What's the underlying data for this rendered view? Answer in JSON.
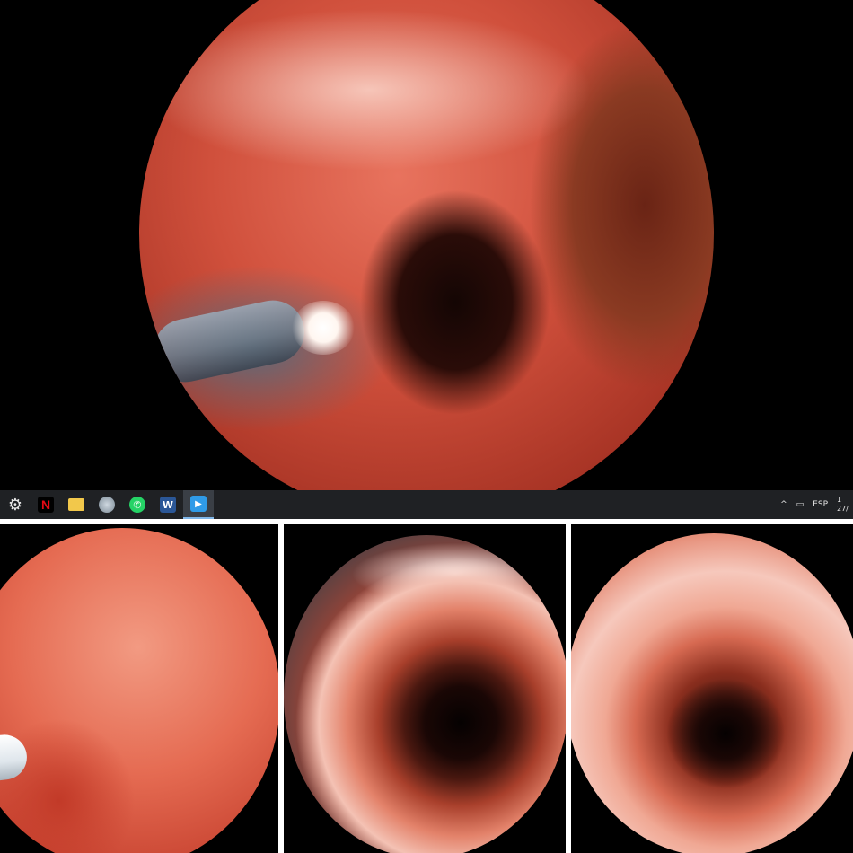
{
  "main_view": {
    "description_icon": "endoscopy-view"
  },
  "taskbar": {
    "items": [
      {
        "name": "settings",
        "icon": "gear-icon",
        "glyph": "⚙"
      },
      {
        "name": "netflix",
        "icon": "netflix-icon",
        "glyph": "N"
      },
      {
        "name": "file-explorer",
        "icon": "folder-icon",
        "glyph": ""
      },
      {
        "name": "app",
        "icon": "app-icon",
        "glyph": ""
      },
      {
        "name": "whatsapp",
        "icon": "whatsapp-icon",
        "glyph": "✆"
      },
      {
        "name": "word",
        "icon": "word-icon",
        "glyph": "W"
      },
      {
        "name": "media-player",
        "icon": "play-icon",
        "glyph": "▶"
      }
    ],
    "tray": {
      "chevron": "^",
      "language": "ESP",
      "clock_line1": "1",
      "clock_line2": "27/"
    }
  },
  "colors": {
    "taskbar_bg": "#1f2124",
    "active_indicator": "#7fb6e8"
  }
}
